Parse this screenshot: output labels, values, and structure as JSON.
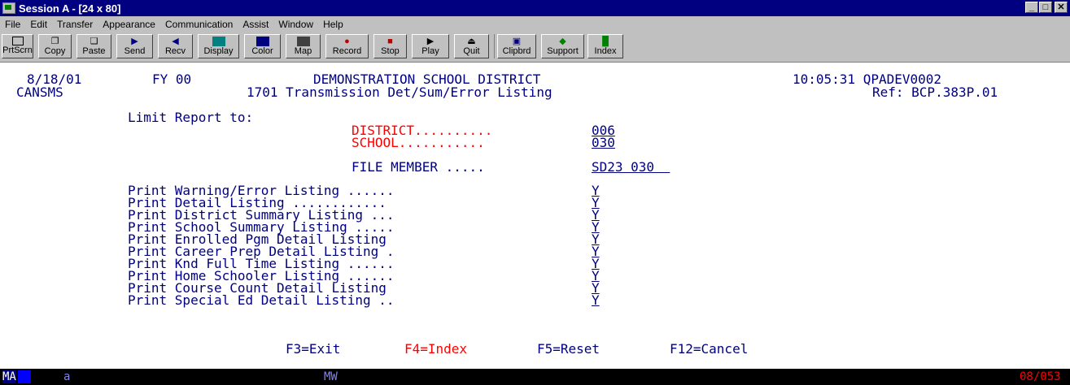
{
  "window": {
    "title": "Session A - [24 x 80]",
    "min": "_",
    "max": "□",
    "close": "✕"
  },
  "menu": [
    "File",
    "Edit",
    "Transfer",
    "Appearance",
    "Communication",
    "Assist",
    "Window",
    "Help"
  ],
  "toolbar": [
    {
      "label": "PrtScrn",
      "icon": "print-screen-icon"
    },
    {
      "label": "Copy",
      "icon": "copy-icon"
    },
    {
      "label": "Paste",
      "icon": "paste-icon"
    },
    {
      "label": "Send",
      "icon": "send-icon"
    },
    {
      "label": "Recv",
      "icon": "receive-icon"
    },
    {
      "label": "Display",
      "icon": "display-icon"
    },
    {
      "label": "Color",
      "icon": "color-icon"
    },
    {
      "label": "Map",
      "icon": "map-icon"
    },
    {
      "label": "Record",
      "icon": "record-icon"
    },
    {
      "label": "Stop",
      "icon": "stop-icon"
    },
    {
      "label": "Play",
      "icon": "play-icon"
    },
    {
      "label": "Quit",
      "icon": "quit-icon"
    },
    {
      "label": "Clipbrd",
      "icon": "clipboard-icon"
    },
    {
      "label": "Support",
      "icon": "support-icon"
    },
    {
      "label": "Index",
      "icon": "index-icon"
    }
  ],
  "screen": {
    "date": "8/18/01",
    "fy": "FY 00",
    "district_name": "DEMONSTRATION SCHOOL DISTRICT",
    "time_session": "10:05:31 QPADEV0002",
    "program": "CANSMS",
    "report_title": "1701 Transmission Det/Sum/Error Listing",
    "ref": "Ref: BCP.383P.01",
    "limit_label": "Limit Report to:",
    "district_label": "DISTRICT..........",
    "district_value": "006",
    "school_label": "SCHOOL...........",
    "school_value": "030",
    "file_member_label": "FILE MEMBER .....",
    "file_member_value": "SD23 030  ",
    "options": [
      {
        "label": "Print Warning/Error Listing ......",
        "value": "Y"
      },
      {
        "label": "Print Detail Listing ............",
        "value": "Y"
      },
      {
        "label": "Print District Summary Listing ...",
        "value": "Y"
      },
      {
        "label": "Print School Summary Listing .....",
        "value": "Y"
      },
      {
        "label": "Print Enrolled Pgm Detail Listing ",
        "value": "Y"
      },
      {
        "label": "Print Career Prep Detail Listing .",
        "value": "Y"
      },
      {
        "label": "Print Knd Full Time Listing ......",
        "value": "Y"
      },
      {
        "label": "Print Home Schooler Listing ......",
        "value": "Y"
      },
      {
        "label": "Print Course Count Detail Listing ",
        "value": "Y"
      },
      {
        "label": "Print Special Ed Detail Listing ..",
        "value": "Y"
      }
    ],
    "fkeys": {
      "f3": "F3=Exit",
      "f4": "F4=Index",
      "f5": "F5=Reset",
      "f12": "F12=Cancel"
    }
  },
  "status": {
    "mode": "MA",
    "session": "a",
    "mw": "MW",
    "cursor": "08/053"
  },
  "colors": {
    "screen_text": "#000080",
    "highlight": "#ff0000",
    "status_bg": "#000000",
    "status_text": "#8080ff"
  }
}
